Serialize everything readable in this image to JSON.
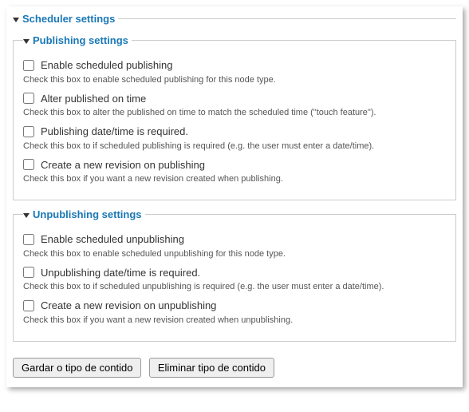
{
  "scheduler": {
    "title": "Scheduler settings",
    "publishing": {
      "title": "Publishing settings",
      "items": [
        {
          "label": "Enable scheduled publishing",
          "desc": "Check this box to enable scheduled publishing for this node type."
        },
        {
          "label": "Alter published on time",
          "desc": "Check this box to alter the published on time to match the scheduled time (\"touch feature\")."
        },
        {
          "label": "Publishing date/time is required.",
          "desc": "Check this box to if scheduled publishing is required (e.g. the user must enter a date/time)."
        },
        {
          "label": "Create a new revision on publishing",
          "desc": "Check this box if you want a new revision created when publishing."
        }
      ]
    },
    "unpublishing": {
      "title": "Unpublishing settings",
      "items": [
        {
          "label": "Enable scheduled unpublishing",
          "desc": "Check this box to enable scheduled unpublishing for this node type."
        },
        {
          "label": "Unpublishing date/time is required.",
          "desc": "Check this box to if scheduled unpublishing is required (e.g. the user must enter a date/time)."
        },
        {
          "label": "Create a new revision on unpublishing",
          "desc": "Check this box if you want a new revision created when unpublishing."
        }
      ]
    }
  },
  "actions": {
    "save": "Gardar o tipo de contido",
    "delete": "Eliminar tipo de contido"
  }
}
